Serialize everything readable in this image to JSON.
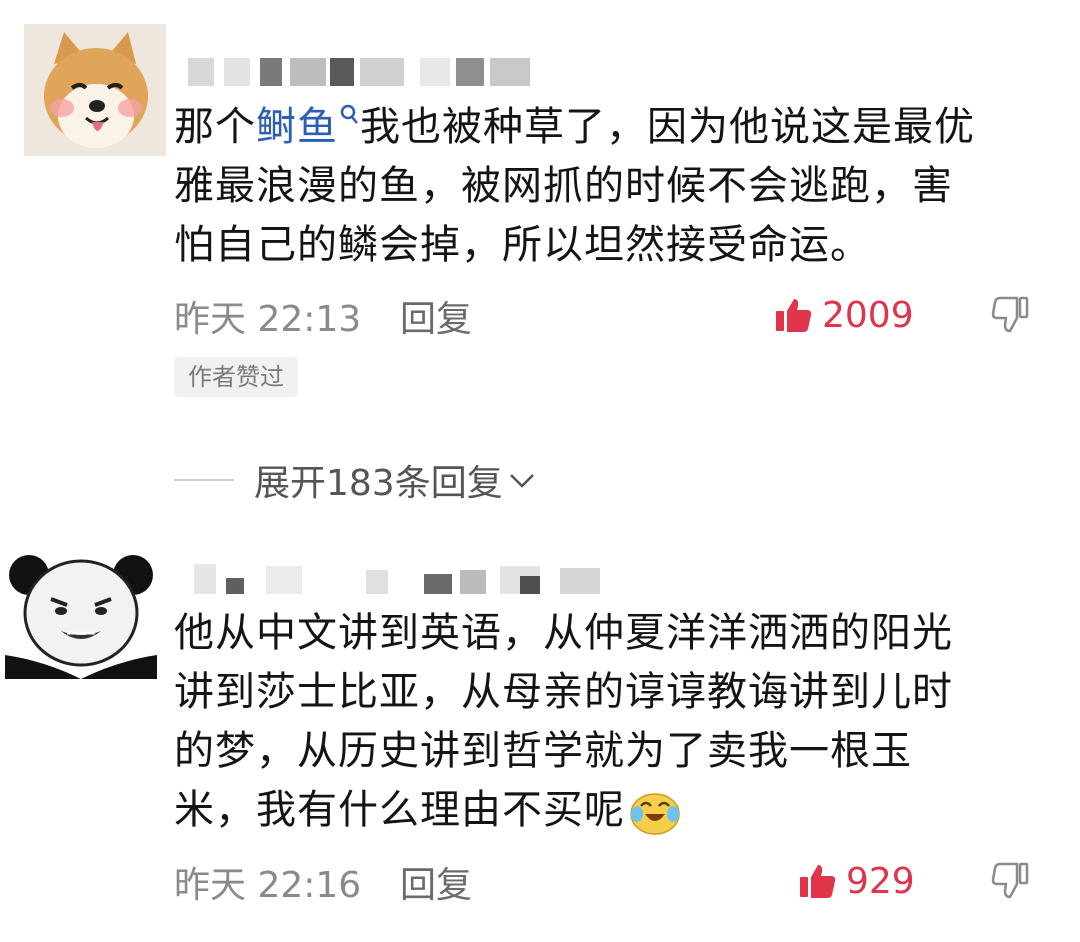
{
  "comments": [
    {
      "text_parts": [
        "那个",
        "鲥鱼",
        "我也被种草了，因为他说这是最优雅最浪漫的鱼，被网抓的时候不会逃跑，害怕自己的鳞会掉，所以坦然接受命运。"
      ],
      "lines": [
        "那个",
        "鲥鱼",
        "我也被种草了，因为他说这是最优",
        "雅最浪漫的鱼，被网抓的时候不会逃跑，害",
        "怕自己的鳞会掉，所以坦然接受命运。"
      ],
      "time": "昨天 22:13",
      "reply": "回复",
      "likes": "2009",
      "badge": "作者赞过"
    },
    {
      "lines": [
        "他从中文讲到英语，从仲夏洋洋洒洒的阳光",
        "讲到莎士比亚，从母亲的谆谆教诲讲到儿时",
        "的梦，从历史讲到哲学就为了卖我一根玉",
        "米，我有什么理由不买呢"
      ],
      "time": "昨天 22:16",
      "reply": "回复",
      "likes": "929"
    }
  ],
  "expand": {
    "label": "展开183条回复"
  },
  "colors": {
    "accent_like": "#e0344a",
    "link": "#2a5fb5",
    "meta": "#8a8a8a"
  },
  "icons": [
    "search-mini-icon",
    "thumb-up-icon",
    "thumb-down-icon",
    "chevron-down-icon",
    "crying-laugh-emoji-icon"
  ]
}
